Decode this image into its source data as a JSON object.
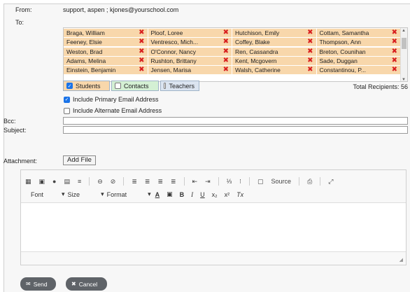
{
  "from": {
    "label": "From:",
    "value": "support, aspen ; kjones@yourschool.com"
  },
  "to": {
    "label": "To:",
    "recipients": [
      [
        "Braga, William",
        "Ploof, Loree",
        "Hutchison, Emily",
        "Cottam, Samantha"
      ],
      [
        "Feeney, Elsie",
        "Ventresco, Mich...",
        "Coffey, Blake",
        "Thompson, Ann"
      ],
      [
        "Weston, Brad",
        "O'Connor, Nancy",
        "Ren, Cassandra",
        "Breton, Counihan"
      ],
      [
        "Adams, Melina",
        "Rushton, Brittany",
        "Kent, Mcgovern",
        "Sade, Duggan"
      ],
      [
        "Einstein, Benjamin",
        "Jensen, Marisa",
        "Walsh, Catherine",
        "Constantinou, P..."
      ]
    ]
  },
  "filters": {
    "students": "Students",
    "contacts": "Contacts",
    "teachers": "Teachers"
  },
  "total_recipients": "Total Recipients: 56",
  "options": {
    "primary": "Include Primary Email Address",
    "alternate": "Include Alternate Email Address"
  },
  "bcc": {
    "label": "Bcc:"
  },
  "subject": {
    "label": "Subject:"
  },
  "attachment": {
    "label": "Attachment:",
    "button": "Add File"
  },
  "toolbar": {
    "source": "Source",
    "font": "Font",
    "size": "Size",
    "format": "Format"
  },
  "actions": {
    "send": "Send",
    "cancel": "Cancel"
  }
}
